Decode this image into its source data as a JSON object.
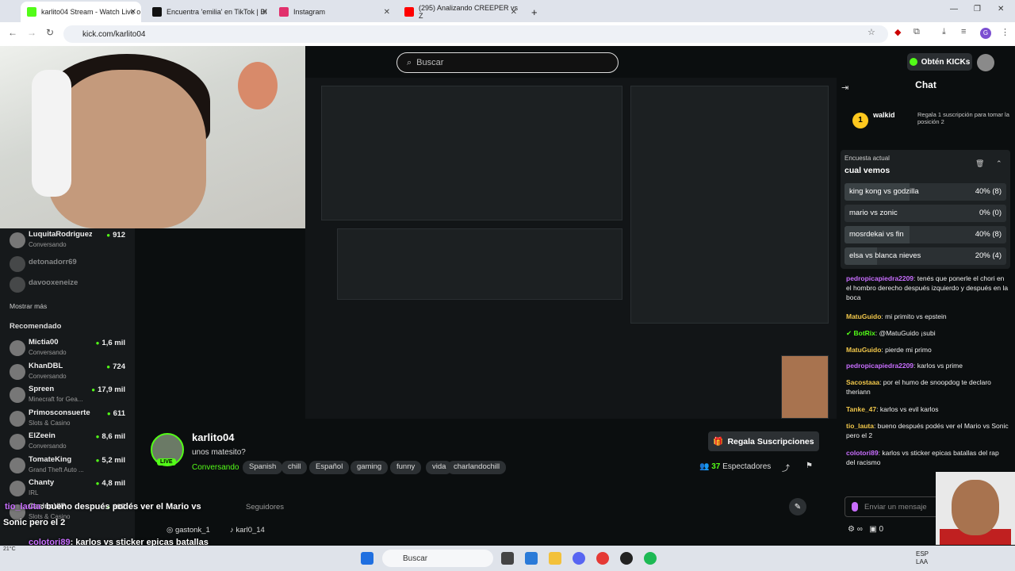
{
  "browser": {
    "tabs": [
      {
        "label": "karlito04 Stream - Watch Live o",
        "active": true
      },
      {
        "label": "Encuentra 'emilia' en TikTok | Bi"
      },
      {
        "label": "Instagram"
      },
      {
        "label": "(295) Analizando CREEPER vs Z"
      }
    ],
    "url": "kick.com/karlito04"
  },
  "header": {
    "search_placeholder": "Buscar",
    "kicks_label": "Obtén KICKs"
  },
  "sidebar": {
    "following": [
      {
        "name": "LuquitaRodriguez",
        "status": "Conversando",
        "viewers": "912"
      },
      {
        "name": "detonadorr69",
        "status": "",
        "viewers": ""
      },
      {
        "name": "davooxeneize",
        "status": "",
        "viewers": ""
      }
    ],
    "show_more": "Mostrar más",
    "recommended_title": "Recomendado",
    "recommended": [
      {
        "name": "Mictia00",
        "status": "Conversando",
        "viewers": "1,6 mil"
      },
      {
        "name": "KhanDBL",
        "status": "Conversando",
        "viewers": "724"
      },
      {
        "name": "Spreen",
        "status": "Minecraft for Gea...",
        "viewers": "17,9 mil"
      },
      {
        "name": "Primosconsuerte",
        "status": "Slots & Casino",
        "viewers": "611"
      },
      {
        "name": "ElZeein",
        "status": "Conversando",
        "viewers": "8,6 mil"
      },
      {
        "name": "TomateKing",
        "status": "Grand Theft Auto ...",
        "viewers": "5,2 mil"
      },
      {
        "name": "Chanty",
        "status": "IRL",
        "viewers": "4,8 mil"
      },
      {
        "name": "CasinoVIP",
        "status": "Slots & Casino",
        "viewers": "697"
      }
    ]
  },
  "stream": {
    "channel": "karlito04",
    "title": "unos matesito?",
    "category": "Conversando",
    "tags": [
      "Spanish",
      "chill",
      "Español",
      "gaming",
      "funny",
      "vida",
      "charlandochill"
    ],
    "subs_label": "Regala Suscripciones",
    "viewers_count": "37",
    "viewers_label": "Espectadores",
    "followers_label": "Seguidores",
    "socials": [
      "gastonk_1",
      "karl0_14"
    ],
    "live_badge": "LIVE"
  },
  "overlay": {
    "line1_user": "tio_lauta",
    "line1_text": ": bueno después podés ver el Mario vs",
    "line2_text": "Sonic pero el 2",
    "line3_user": "colotori89",
    "line3_text": ": karlos vs sticker epicas batallas",
    "line4_text": "del rap del racismo"
  },
  "chat": {
    "title": "Chat",
    "pinned_user": "walkid",
    "pinned_coin": "1",
    "pinned_text": "Regala 1 suscripción para tomar la posición 2",
    "poll": {
      "label": "Encuesta actual",
      "question": "cual vemos",
      "options": [
        {
          "name": "king kong vs godzilla",
          "pct": "40% (8)",
          "share": 0.4
        },
        {
          "name": "mario vs zonic",
          "pct": "0% (0)",
          "share": 0
        },
        {
          "name": "mosrdekai vs fin",
          "pct": "40% (8)",
          "share": 0.4
        },
        {
          "name": "elsa vs blanca nieves",
          "pct": "20% (4)",
          "share": 0.2
        }
      ]
    },
    "messages": [
      {
        "user": "pedropicapiedra2209",
        "text": ": tenés que ponerle el chori en el hombro derecho después izquierdo y después en la boca"
      },
      {
        "user": "MatuGuido",
        "text": ": mi primito vs epstein"
      },
      {
        "user": "BotRix",
        "text": ": @MatuGuido ¡subi"
      },
      {
        "user": "MatuGuido",
        "text": ": pierde mi primo"
      },
      {
        "user": "pedropicapiedra2209",
        "text": ": karlos vs prime"
      },
      {
        "user": "Sacostaaa",
        "text": ": por el humo de snoopdog te declaro theriann"
      },
      {
        "user": "Tanke_47",
        "text": ": karlos vs evil karlos"
      },
      {
        "user": "tio_lauta",
        "text": ": bueno después podés ver el Mario vs Sonic pero el 2"
      },
      {
        "user": "colotori89",
        "text": ": karlos vs sticker epicas batallas del rap del racismo"
      }
    ],
    "input_placeholder": "Enviar un mensaje",
    "footer_count": "0"
  },
  "taskbar": {
    "search_placeholder": "Buscar",
    "lang": "ESP",
    "layout": "LAA",
    "weather": "21°C"
  },
  "colors": {
    "accent": "#53fc18",
    "chat_user": "#c96eff"
  }
}
